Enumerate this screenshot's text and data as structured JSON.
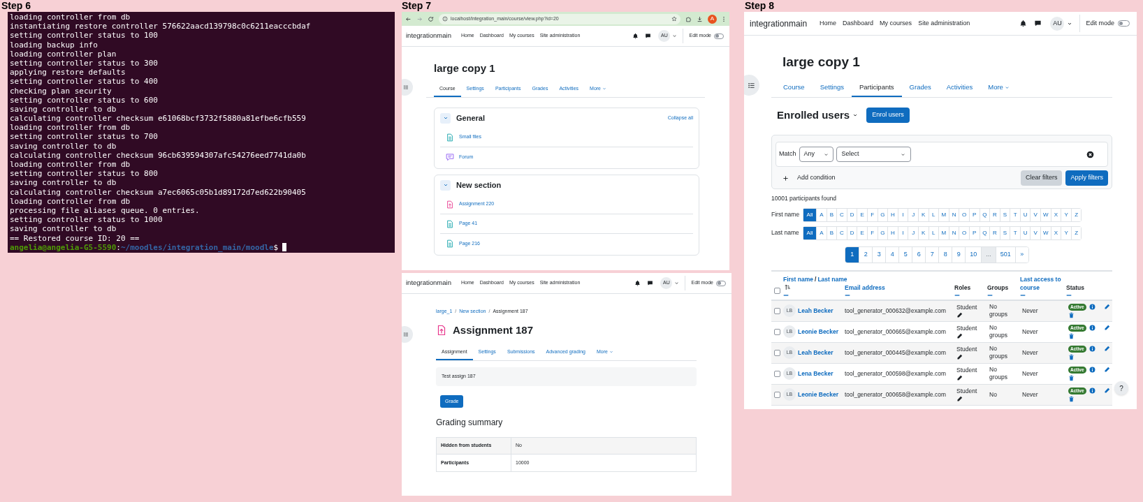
{
  "step6": {
    "label": "Step 6",
    "terminal": {
      "lines": [
        "loading controller from db",
        "instantiating restore controller 576622aacd139798c0c6211eacccbdaf",
        "setting controller status to 100",
        "loading backup info",
        "loading controller plan",
        "setting controller status to 300",
        "applying restore defaults",
        "setting controller status to 400",
        "checking plan security",
        "setting controller status to 600",
        "saving controller to db",
        "calculating controller checksum e61068bcf3732f5880a81efbe6cfb559",
        "loading controller from db",
        "setting controller status to 700",
        "saving controller to db",
        "calculating controller checksum 96cb639594307afc54276eed7741da0b",
        "loading controller from db",
        "setting controller status to 800",
        "saving controller to db",
        "calculating controller checksum a7ec6065c05b1d89172d7ed622b90405",
        "loading controller from db",
        "processing file aliases queue. 0 entries.",
        "setting controller status to 1000",
        "saving controller to db",
        "== Restored course ID: 20 =="
      ],
      "prompt": {
        "user": "angelia@angelia-G5-5590",
        "separator": ":",
        "path": "~/moodles/integration_main/moodle",
        "symbol": "$"
      }
    }
  },
  "step7": {
    "label": "Step 7",
    "course_page": {
      "browser": {
        "url": "localhost/integration_main/course/view.php?id=20",
        "profile_initial": "A"
      },
      "navbar": {
        "site_name": "integrationmain",
        "links": [
          "Home",
          "Dashboard",
          "My courses",
          "Site administration"
        ],
        "avatar": "AU",
        "edit_mode": {
          "label": "Edit mode",
          "on": false
        }
      },
      "title": "large copy 1",
      "tabs": [
        {
          "label": "Course",
          "kind": "link",
          "selected": true
        },
        {
          "label": "Settings",
          "kind": "link",
          "selected": false
        },
        {
          "label": "Participants",
          "kind": "link",
          "selected": false
        },
        {
          "label": "Grades",
          "kind": "link",
          "selected": false
        },
        {
          "label": "Activities",
          "kind": "link",
          "selected": false
        },
        {
          "label": "More",
          "kind": "menu",
          "selected": false
        }
      ],
      "sections": [
        {
          "title": "General",
          "expanded": true,
          "action": "Collapse all",
          "activities": [
            {
              "kind": "page",
              "name": "Small files"
            },
            {
              "kind": "forum",
              "name": "Forum"
            }
          ]
        },
        {
          "title": "New section",
          "expanded": true,
          "activities": [
            {
              "kind": "assignment",
              "name": "Assignment 220"
            },
            {
              "kind": "page",
              "name": "Page 41"
            },
            {
              "kind": "page",
              "name": "Page 216"
            }
          ]
        }
      ]
    },
    "assignment_page": {
      "navbar": {
        "site_name": "integrationmain",
        "links": [
          "Home",
          "Dashboard",
          "My courses",
          "Site administration"
        ],
        "avatar": "AU",
        "edit_mode": {
          "label": "Edit mode",
          "on": false
        }
      },
      "breadcrumb": [
        {
          "text": "large_1",
          "kind": "link",
          "separator": "/"
        },
        {
          "text": "New section",
          "kind": "link",
          "separator": "/"
        },
        {
          "text": "Assignment 187",
          "kind": "current"
        }
      ],
      "title": "Assignment 187",
      "tabs": [
        {
          "label": "Assignment",
          "kind": "link",
          "selected": true
        },
        {
          "label": "Settings",
          "kind": "link",
          "selected": false
        },
        {
          "label": "Submissions",
          "kind": "link",
          "selected": false
        },
        {
          "label": "Advanced grading",
          "kind": "link",
          "selected": false
        },
        {
          "label": "More",
          "kind": "menu",
          "selected": false
        }
      ],
      "description": "Test assign 187",
      "grade_button": "Grade",
      "summary_heading": "Grading summary",
      "summary_rows": [
        {
          "label": "Hidden from students",
          "value": "No"
        },
        {
          "label": "Participants",
          "value": "10000"
        }
      ]
    }
  },
  "step8": {
    "label": "Step 8",
    "navbar": {
      "site_name": "integrationmain",
      "links": [
        "Home",
        "Dashboard",
        "My courses",
        "Site administration"
      ],
      "avatar": "AU",
      "edit_mode": {
        "label": "Edit mode",
        "on": false
      }
    },
    "title": "large copy 1",
    "tabs": [
      {
        "label": "Course",
        "kind": "link",
        "selected": false
      },
      {
        "label": "Settings",
        "kind": "link",
        "selected": false
      },
      {
        "label": "Participants",
        "kind": "link",
        "selected": true
      },
      {
        "label": "Grades",
        "kind": "link",
        "selected": false
      },
      {
        "label": "Activities",
        "kind": "link",
        "selected": false
      },
      {
        "label": "More",
        "kind": "menu",
        "selected": false
      }
    ],
    "page_heading": "Enrolled users",
    "enrol_button": "Enrol users",
    "filter": {
      "match_label": "Match",
      "match_value": "Any",
      "condition_value": "Select",
      "add_condition": "Add condition",
      "clear_button": "Clear filters",
      "apply_button": "Apply filters"
    },
    "found": "10001 participants found",
    "initials_filters": [
      {
        "label": "First name",
        "options": [
          {
            "text": "All",
            "selected": true
          },
          {
            "text": "A",
            "selected": false
          },
          {
            "text": "B",
            "selected": false
          },
          {
            "text": "C",
            "selected": false
          },
          {
            "text": "D",
            "selected": false
          },
          {
            "text": "E",
            "selected": false
          },
          {
            "text": "F",
            "selected": false
          },
          {
            "text": "G",
            "selected": false
          },
          {
            "text": "H",
            "selected": false
          },
          {
            "text": "I",
            "selected": false
          },
          {
            "text": "J",
            "selected": false
          },
          {
            "text": "K",
            "selected": false
          },
          {
            "text": "L",
            "selected": false
          },
          {
            "text": "M",
            "selected": false
          },
          {
            "text": "N",
            "selected": false
          },
          {
            "text": "O",
            "selected": false
          },
          {
            "text": "P",
            "selected": false
          },
          {
            "text": "Q",
            "selected": false
          },
          {
            "text": "R",
            "selected": false
          },
          {
            "text": "S",
            "selected": false
          },
          {
            "text": "T",
            "selected": false
          },
          {
            "text": "U",
            "selected": false
          },
          {
            "text": "V",
            "selected": false
          },
          {
            "text": "W",
            "selected": false
          },
          {
            "text": "X",
            "selected": false
          },
          {
            "text": "Y",
            "selected": false
          },
          {
            "text": "Z",
            "selected": false
          }
        ]
      },
      {
        "label": "Last name",
        "options": [
          {
            "text": "All",
            "selected": true
          },
          {
            "text": "A",
            "selected": false
          },
          {
            "text": "B",
            "selected": false
          },
          {
            "text": "C",
            "selected": false
          },
          {
            "text": "D",
            "selected": false
          },
          {
            "text": "E",
            "selected": false
          },
          {
            "text": "F",
            "selected": false
          },
          {
            "text": "G",
            "selected": false
          },
          {
            "text": "H",
            "selected": false
          },
          {
            "text": "I",
            "selected": false
          },
          {
            "text": "J",
            "selected": false
          },
          {
            "text": "K",
            "selected": false
          },
          {
            "text": "L",
            "selected": false
          },
          {
            "text": "M",
            "selected": false
          },
          {
            "text": "N",
            "selected": false
          },
          {
            "text": "O",
            "selected": false
          },
          {
            "text": "P",
            "selected": false
          },
          {
            "text": "Q",
            "selected": false
          },
          {
            "text": "R",
            "selected": false
          },
          {
            "text": "S",
            "selected": false
          },
          {
            "text": "T",
            "selected": false
          },
          {
            "text": "U",
            "selected": false
          },
          {
            "text": "V",
            "selected": false
          },
          {
            "text": "W",
            "selected": false
          },
          {
            "text": "X",
            "selected": false
          },
          {
            "text": "Y",
            "selected": false
          },
          {
            "text": "Z",
            "selected": false
          }
        ]
      }
    ],
    "pagination": [
      {
        "text": "1",
        "kind": "page",
        "selected": true
      },
      {
        "text": "2",
        "kind": "page",
        "selected": false
      },
      {
        "text": "3",
        "kind": "page",
        "selected": false
      },
      {
        "text": "4",
        "kind": "page",
        "selected": false
      },
      {
        "text": "5",
        "kind": "page",
        "selected": false
      },
      {
        "text": "6",
        "kind": "page",
        "selected": false
      },
      {
        "text": "7",
        "kind": "page",
        "selected": false
      },
      {
        "text": "8",
        "kind": "page",
        "selected": false
      },
      {
        "text": "9",
        "kind": "page",
        "selected": false
      },
      {
        "text": "10",
        "kind": "page",
        "selected": false
      },
      {
        "text": "...",
        "kind": "gap",
        "selected": false
      },
      {
        "text": "501",
        "kind": "page",
        "selected": false
      },
      {
        "text": "»",
        "kind": "next",
        "selected": false
      }
    ],
    "table": {
      "select_all": false,
      "columns": [
        {
          "kind": "name",
          "first": "First name",
          "separator": "/",
          "last": "Last name",
          "sorted": true
        },
        {
          "kind": "text",
          "text": "Email address",
          "link": true
        },
        {
          "kind": "text",
          "text": "Roles",
          "link": false
        },
        {
          "kind": "text",
          "text": "Groups",
          "link": false
        },
        {
          "kind": "text",
          "text": "Last access to course",
          "link": true
        },
        {
          "kind": "text",
          "text": "Status",
          "link": false
        }
      ],
      "rows": [
        {
          "selected": false,
          "initials": "LB",
          "name": "Leah Becker",
          "email": "tool_generator_000632@example.com",
          "role": "Student",
          "groups": "No groups",
          "last_access": "Never",
          "status": "Active"
        },
        {
          "selected": false,
          "initials": "LB",
          "name": "Leonie Becker",
          "email": "tool_generator_000665@example.com",
          "role": "Student",
          "groups": "No groups",
          "last_access": "Never",
          "status": "Active"
        },
        {
          "selected": false,
          "initials": "LB",
          "name": "Leah Becker",
          "email": "tool_generator_000445@example.com",
          "role": "Student",
          "groups": "No groups",
          "last_access": "Never",
          "status": "Active"
        },
        {
          "selected": false,
          "initials": "LB",
          "name": "Lena Becker",
          "email": "tool_generator_000598@example.com",
          "role": "Student",
          "groups": "No groups",
          "last_access": "Never",
          "status": "Active"
        },
        {
          "selected": false,
          "initials": "LB",
          "name": "Leonie Becker",
          "email": "tool_generator_000658@example.com",
          "role": "Student",
          "groups": "No",
          "last_access": "Never",
          "status": "Active"
        }
      ]
    },
    "help_button": "?"
  }
}
